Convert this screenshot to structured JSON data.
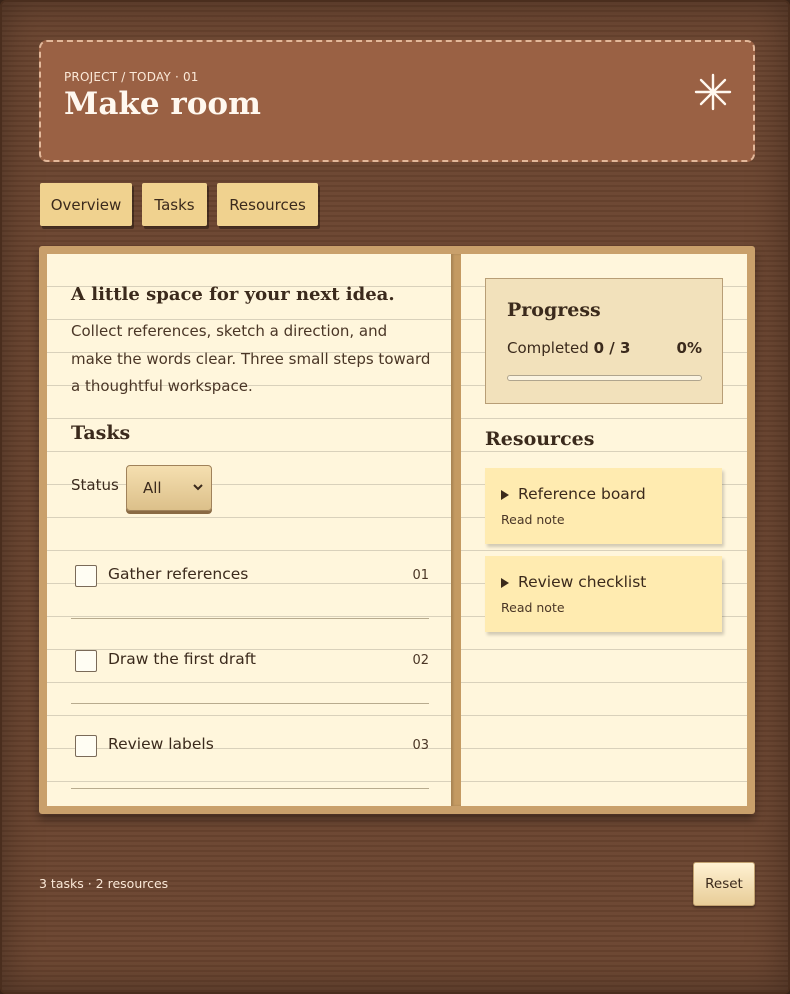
{
  "header": {
    "breadcrumb": "PROJECT / TODAY · 01",
    "title": "Make room",
    "icon": "sparkle-icon"
  },
  "tabs": [
    {
      "label": "Overview"
    },
    {
      "label": "Tasks"
    },
    {
      "label": "Resources"
    }
  ],
  "intro": {
    "heading": "A little space for your next idea.",
    "body": "Collect references, sketch a direction, and make the words clear. Three small steps toward a thoughtful workspace."
  },
  "tasks": {
    "heading": "Tasks",
    "filter_label": "Status",
    "filter_value": "All",
    "items": [
      {
        "label": "Gather references",
        "num": "01",
        "checked": false
      },
      {
        "label": "Draw the first draft",
        "num": "02",
        "checked": false
      },
      {
        "label": "Review labels",
        "num": "03",
        "checked": false
      }
    ]
  },
  "progress": {
    "heading": "Progress",
    "completed_label": "Completed",
    "completed_value": "0 / 3",
    "percent_label": "0%",
    "fraction": 0.0
  },
  "resources": {
    "heading": "Resources",
    "items": [
      {
        "title": "Reference board",
        "link": "Read note"
      },
      {
        "title": "Review checklist",
        "link": "Read note"
      }
    ]
  },
  "footer": {
    "summary": "3 tasks · 2 resources",
    "reset_label": "Reset"
  },
  "colors": {
    "header_bg": "#9a6144",
    "tab_bg": "#f0d28f",
    "page_bg": "#fff6dc",
    "note_bg": "#ffebb0",
    "wood": "#6b4530"
  }
}
